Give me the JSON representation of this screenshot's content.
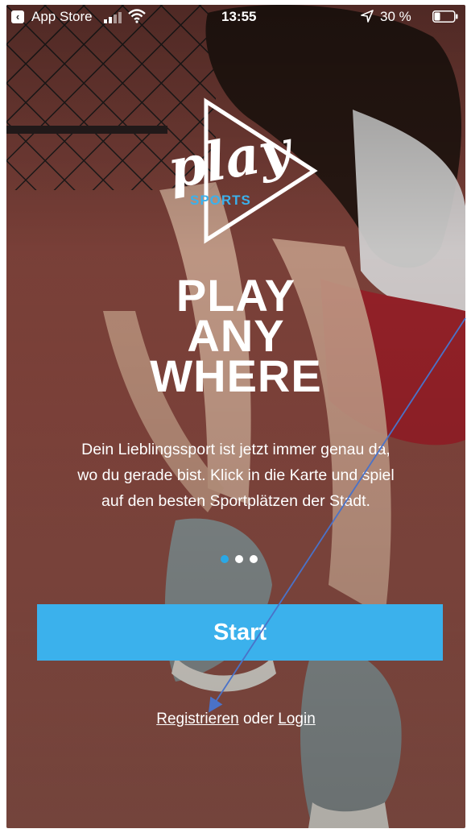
{
  "status_bar": {
    "back_app": "App Store",
    "time": "13:55",
    "battery_text": "30 %",
    "battery_level_percent": 30
  },
  "logo": {
    "word": "play",
    "sub": "SPORTS"
  },
  "headline": {
    "line1": "PLAY",
    "line2": "ANY",
    "line3": "WHERE"
  },
  "body": {
    "line1": "Dein Lieblingssport ist jetzt immer genau da,",
    "line2": "wo du gerade bist. Klick in die Karte und spiel",
    "line3": "auf den besten Sportplätzen der Stadt."
  },
  "pager": {
    "count": 3,
    "active_index": 0
  },
  "start_button": {
    "label": "Start"
  },
  "auth": {
    "register_label": "Registrieren",
    "separator": "oder",
    "login_label": "Login"
  },
  "colors": {
    "accent": "#3bb1ec",
    "background_court": "#8e4b42",
    "annotation_arrow": "#4a72c8"
  },
  "icons": [
    "back-icon",
    "signal-icon",
    "wifi-icon",
    "location-arrow-icon",
    "battery-icon",
    "play-triangle-icon",
    "annotation-arrow-icon"
  ]
}
